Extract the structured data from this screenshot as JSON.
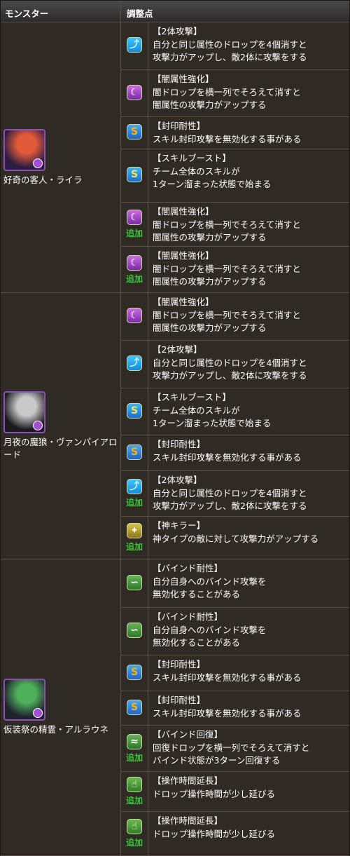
{
  "header": {
    "monster": "モンスター",
    "adjust": "調整点"
  },
  "monsters": [
    {
      "name": "好奇の客人・ライラ",
      "awakenings": [
        {
          "icon": "two-pronged-attack-icon",
          "style": "dark-t",
          "glyph": "⤴",
          "title": "【2体攻撃】",
          "lines": [
            "自分と同じ属性のドロップを4個消すと",
            "攻撃力がアップし、敵2体に攻撃をする"
          ],
          "added": ""
        },
        {
          "icon": "enhanced-dark-orbs-icon",
          "style": "dark-e",
          "glyph": "☾",
          "title": "【闇属性強化】",
          "lines": [
            "闇ドロップを横一列でそろえて消すと",
            "闇属性の攻撃力がアップする"
          ],
          "added": ""
        },
        {
          "icon": "skill-bind-resist-icon",
          "style": "seal",
          "glyph": "S",
          "title": "【封印耐性】",
          "lines": [
            "スキル封印攻撃を無効化する事がある"
          ],
          "added": ""
        },
        {
          "icon": "skill-boost-icon",
          "style": "skill",
          "glyph": "S",
          "title": "【スキルブースト】",
          "lines": [
            "チーム全体のスキルが",
            "1ターン溜まった状態で始まる"
          ],
          "added": ""
        },
        {
          "icon": "enhanced-dark-orbs-icon",
          "style": "dark-e",
          "glyph": "☾",
          "title": "【闇属性強化】",
          "lines": [
            "闇ドロップを横一列でそろえて消すと",
            "闇属性の攻撃力がアップする"
          ],
          "added": "追加"
        },
        {
          "icon": "enhanced-dark-orbs-icon",
          "style": "dark-e",
          "glyph": "☾",
          "title": "【闇属性強化】",
          "lines": [
            "闇ドロップを横一列でそろえて消すと",
            "闇属性の攻撃力がアップする"
          ],
          "added": "追加"
        }
      ]
    },
    {
      "name": "月夜の魔狼・ヴァンパイアロード",
      "awakenings": [
        {
          "icon": "enhanced-dark-orbs-icon",
          "style": "dark-e",
          "glyph": "☾",
          "title": "【闇属性強化】",
          "lines": [
            "闇ドロップを横一列でそろえて消すと",
            "闇属性の攻撃力がアップする"
          ],
          "added": ""
        },
        {
          "icon": "two-pronged-attack-icon",
          "style": "dark-t",
          "glyph": "⤴",
          "title": "【2体攻撃】",
          "lines": [
            "自分と同じ属性のドロップを4個消すと",
            "攻撃力がアップし、敵2体に攻撃をする"
          ],
          "added": ""
        },
        {
          "icon": "skill-boost-icon",
          "style": "skill",
          "glyph": "S",
          "title": "【スキルブースト】",
          "lines": [
            "チーム全体のスキルが",
            "1ターン溜まった状態で始まる"
          ],
          "added": ""
        },
        {
          "icon": "skill-bind-resist-icon",
          "style": "seal",
          "glyph": "S",
          "title": "【封印耐性】",
          "lines": [
            "スキル封印攻撃を無効化する事がある"
          ],
          "added": ""
        },
        {
          "icon": "two-pronged-attack-icon",
          "style": "dark-t",
          "glyph": "⤴",
          "title": "【2体攻撃】",
          "lines": [
            "自分と同じ属性のドロップを4個消すと",
            "攻撃力がアップし、敵2体に攻撃をする"
          ],
          "added": "追加"
        },
        {
          "icon": "god-killer-icon",
          "style": "god",
          "glyph": "✦",
          "title": "【神キラー】",
          "lines": [
            "神タイプの敵に対して攻撃力がアップする"
          ],
          "added": "追加"
        }
      ]
    },
    {
      "name": "仮装祭の精霊・アルラウネ",
      "awakenings": [
        {
          "icon": "bind-resist-icon",
          "style": "bind",
          "glyph": "∽",
          "title": "【バインド耐性】",
          "lines": [
            "自分自身へのバインド攻撃を",
            "無効化することがある"
          ],
          "added": ""
        },
        {
          "icon": "bind-resist-icon",
          "style": "bind",
          "glyph": "∽",
          "title": "【バインド耐性】",
          "lines": [
            "自分自身へのバインド攻撃を",
            "無効化することがある"
          ],
          "added": ""
        },
        {
          "icon": "skill-bind-resist-icon",
          "style": "seal",
          "glyph": "S",
          "title": "【封印耐性】",
          "lines": [
            "スキル封印攻撃を無効化する事がある"
          ],
          "added": ""
        },
        {
          "icon": "skill-bind-resist-icon",
          "style": "seal",
          "glyph": "S",
          "title": "【封印耐性】",
          "lines": [
            "スキル封印攻撃を無効化する事がある"
          ],
          "added": ""
        },
        {
          "icon": "bind-recovery-icon",
          "style": "bind",
          "glyph": "≈",
          "title": "【バインド回復】",
          "lines": [
            "回復ドロップを横一列でそろえて消すと",
            "バインド状態が3ターン回復する"
          ],
          "added": "追加"
        },
        {
          "icon": "time-extend-icon",
          "style": "hand",
          "glyph": "☝",
          "title": "【操作時間延長】",
          "lines": [
            "ドロップ操作時間が少し延びる"
          ],
          "added": "追加"
        },
        {
          "icon": "time-extend-icon",
          "style": "hand",
          "glyph": "☝",
          "title": "【操作時間延長】",
          "lines": [
            "ドロップ操作時間が少し延びる"
          ],
          "added": "追加"
        }
      ]
    }
  ]
}
